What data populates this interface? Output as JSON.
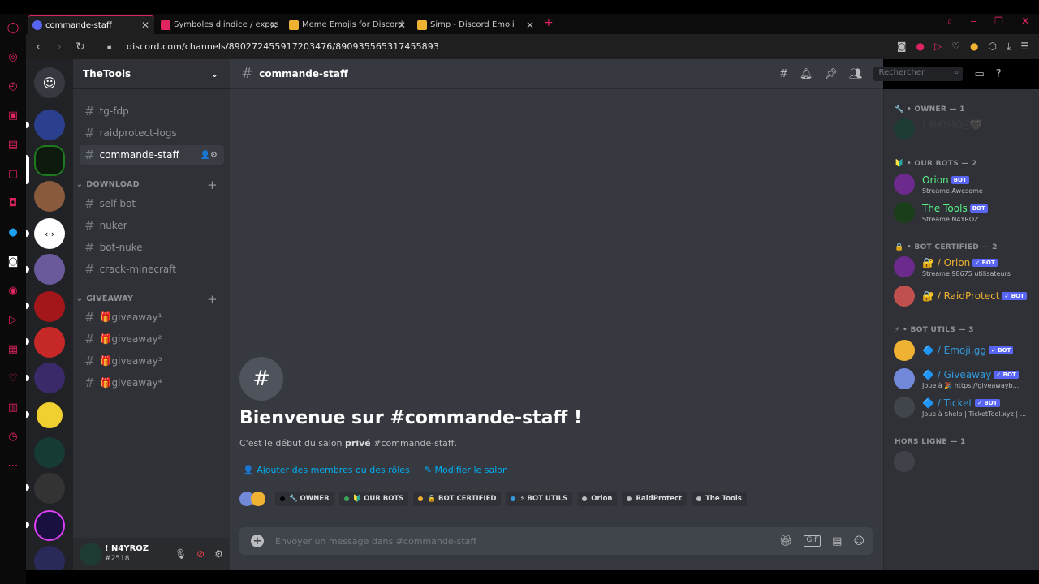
{
  "browser": {
    "tabs": [
      {
        "title": "commande-staff",
        "active": true,
        "favicon_color": "#5865f2"
      },
      {
        "title": "Symboles d'indice / exposa",
        "active": false,
        "favicon_color": "#e0245e"
      },
      {
        "title": "Meme Emojis for Discord &",
        "active": false,
        "favicon_color": "#f0b232"
      },
      {
        "title": "Simp - Discord Emoji",
        "active": false,
        "favicon_color": "#f0b232"
      }
    ],
    "url": "discord.com/channels/890272455917203476/890935565317455893",
    "accent": "#e0245e"
  },
  "server": {
    "name": "TheTools"
  },
  "channels": {
    "top": [
      {
        "name": "tg-fdp"
      },
      {
        "name": "raidprotect-logs"
      },
      {
        "name": "commande-staff",
        "selected": true
      }
    ],
    "categories": [
      {
        "name": "DOWNLOAD",
        "items": [
          {
            "name": "self-bot"
          },
          {
            "name": "nuker"
          },
          {
            "name": "bot-nuke"
          },
          {
            "name": "crack-minecraft"
          }
        ]
      },
      {
        "name": "GIVEAWAY",
        "items": [
          {
            "name": "🎁giveaway¹"
          },
          {
            "name": "🎁giveaway²"
          },
          {
            "name": "🎁giveaway³"
          },
          {
            "name": "🎁giveaway⁴"
          }
        ]
      }
    ]
  },
  "user": {
    "name": "! N4YROZ",
    "tag": "#2518"
  },
  "header": {
    "channel": "commande-staff",
    "search_placeholder": "Rechercher"
  },
  "welcome": {
    "title": "Bienvenue sur #commande-staff !",
    "sub_prefix": "C'est le début du salon ",
    "sub_bold": "privé",
    "sub_suffix": " #commande-staff.",
    "add_members": "Ajouter des membres ou des rôles",
    "edit_channel": "Modifier le salon"
  },
  "roles": [
    {
      "label": "🔧 OWNER",
      "color": "#000000"
    },
    {
      "label": "🔰 OUR BOTS",
      "color": "#3ba55d"
    },
    {
      "label": "🔒 BOT CERTIFIED",
      "color": "#f0b232"
    },
    {
      "label": "⚡ BOT UTILS",
      "color": "#3498db"
    },
    {
      "label": "Orion",
      "color": "#b9bbbe"
    },
    {
      "label": "RaidProtect",
      "color": "#b9bbbe"
    },
    {
      "label": "The Tools",
      "color": "#b9bbbe"
    }
  ],
  "composer": {
    "placeholder": "Envoyer un message dans #commande-staff"
  },
  "members": {
    "groups": [
      {
        "title": "🔧 • OWNER — 1",
        "members": [
          {
            "name": "! N4YROZ🖤",
            "status": "",
            "color": "#2f3136",
            "bot": false,
            "avatar": "#1d3b33"
          }
        ]
      },
      {
        "title": "🔰 • OUR BOTS — 2",
        "members": [
          {
            "name": "Orion",
            "status": "Streame Awesome",
            "color": "#57f287",
            "bot": true,
            "badge": "BOT",
            "avatar": "#6b2a8c"
          },
          {
            "name": "The Tools",
            "status": "Streame N4YROZ",
            "color": "#57f287",
            "bot": true,
            "badge": "BOT",
            "avatar": "#1a3d1a"
          }
        ]
      },
      {
        "title": "🔒 • BOT CERTIFIED — 2",
        "members": [
          {
            "name": "🔐 / Orion",
            "status": "Streame 98675 utilisateurs",
            "color": "#f0b232",
            "bot": true,
            "badge": "✓ BOT",
            "avatar": "#6b2a8c"
          },
          {
            "name": "🔐 / RaidProtect",
            "status": "",
            "color": "#f0b232",
            "bot": true,
            "badge": "✓ BOT",
            "avatar": "#c0504d"
          }
        ]
      },
      {
        "title": "⚡ • BOT UTILS — 3",
        "members": [
          {
            "name": "🔷 / Emoji.gg",
            "status": "",
            "color": "#3498db",
            "bot": true,
            "badge": "✓ BOT",
            "avatar": "#f0b232"
          },
          {
            "name": "🔷 / Giveaway",
            "status": "Joue à 🎉 https://giveawayb...",
            "color": "#3498db",
            "bot": true,
            "badge": "✓ BOT",
            "avatar": "#7289da"
          },
          {
            "name": "🔷 / Ticket",
            "status": "Joue à $help | TicketTool.xyz | ...",
            "color": "#3498db",
            "bot": true,
            "badge": "✓ BOT",
            "avatar": "#40444b"
          }
        ]
      },
      {
        "title": "HORS LIGNE — 1",
        "members": [
          {
            "name": "",
            "status": "",
            "color": "#4f545c",
            "bot": false,
            "avatar": "#4f545c"
          }
        ]
      }
    ]
  }
}
